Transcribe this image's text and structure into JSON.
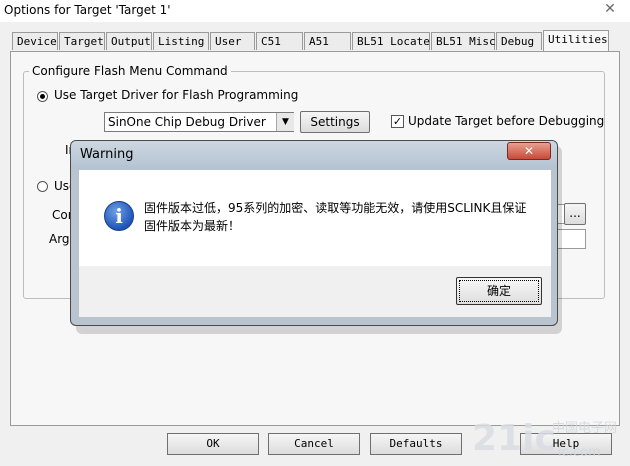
{
  "window": {
    "title": "Options for Target 'Target 1'",
    "close_glyph": "✕"
  },
  "tabs": [
    {
      "label": "Device"
    },
    {
      "label": "Target"
    },
    {
      "label": "Output"
    },
    {
      "label": "Listing"
    },
    {
      "label": "User"
    },
    {
      "label": "C51"
    },
    {
      "label": "A51"
    },
    {
      "label": "BL51 Locate"
    },
    {
      "label": "BL51 Misc"
    },
    {
      "label": "Debug"
    },
    {
      "label": "Utilities",
      "active": true
    }
  ],
  "flash": {
    "group_title": "Configure Flash Menu Command",
    "use_target_driver": "Use Target Driver for Flash Programming",
    "driver_selected": "SinOne Chip Debug Driver",
    "settings_button": "Settings",
    "update_target": "Update Target before Debugging",
    "init_partial": "In",
    "use_external_partial": "Use",
    "command_partial": "Com",
    "arguments_partial": "Argu",
    "browse_button": "..."
  },
  "footer": {
    "ok": "OK",
    "cancel": "Cancel",
    "defaults": "Defaults",
    "help": "Help"
  },
  "warning_dialog": {
    "title": "Warning",
    "close_glyph": "✕",
    "icon_glyph": "i",
    "message": "固件版本过低，95系列的加密、读取等功能无效，请使用SCLINK且保证固件版本为最新！",
    "ok_button": "确定"
  },
  "watermark": {
    "site": "21ic",
    "sub": "中国电子网",
    "domain": "ic.com"
  }
}
